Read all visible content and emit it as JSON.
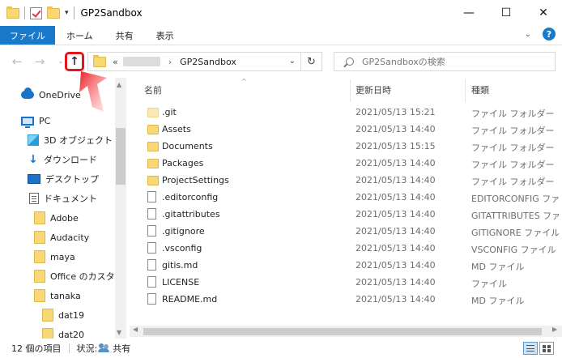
{
  "window": {
    "title": "GP2Sandbox",
    "minimize_glyph": "—",
    "maximize_glyph": "☐",
    "close_glyph": "✕"
  },
  "ribbon": {
    "tabs": [
      "ファイル",
      "ホーム",
      "共有",
      "表示"
    ],
    "help_glyph": "?"
  },
  "address": {
    "prefix": "«",
    "separator": "›",
    "current": "GP2Sandbox",
    "search_placeholder": "GP2Sandboxの検索"
  },
  "icons": {
    "back": "back-arrow-icon",
    "forward": "forward-arrow-icon",
    "up": "up-arrow-icon",
    "refresh": "refresh-icon",
    "search": "search-icon"
  },
  "colors": {
    "accent": "#1979ca",
    "highlight_red": "#e8141c",
    "folder": "#f8d775"
  },
  "sidebar": {
    "items": [
      {
        "label": "OneDrive",
        "icon": "onedrive-icon"
      },
      {
        "label": "PC",
        "icon": "pc-icon"
      },
      {
        "label": "3D オブジェクト",
        "icon": "3d-objects-icon"
      },
      {
        "label": "ダウンロード",
        "icon": "download-icon"
      },
      {
        "label": "デスクトップ",
        "icon": "desktop-icon"
      },
      {
        "label": "ドキュメント",
        "icon": "documents-icon"
      },
      {
        "label": "Adobe",
        "icon": "folder-icon"
      },
      {
        "label": "Audacity",
        "icon": "folder-icon"
      },
      {
        "label": "maya",
        "icon": "folder-icon"
      },
      {
        "label": "Office のカスタム",
        "icon": "folder-icon"
      },
      {
        "label": "tanaka",
        "icon": "folder-icon"
      },
      {
        "label": "dat19",
        "icon": "folder-icon"
      },
      {
        "label": "dat20",
        "icon": "folder-icon"
      }
    ]
  },
  "filelist": {
    "columns": [
      "名前",
      "更新日時",
      "種類"
    ],
    "rows": [
      {
        "name": ".git",
        "date": "2021/05/13 15:21",
        "type": "ファイル フォルダー",
        "kind": "folder"
      },
      {
        "name": "Assets",
        "date": "2021/05/13 14:40",
        "type": "ファイル フォルダー",
        "kind": "folder"
      },
      {
        "name": "Documents",
        "date": "2021/05/13 15:15",
        "type": "ファイル フォルダー",
        "kind": "folder"
      },
      {
        "name": "Packages",
        "date": "2021/05/13 14:40",
        "type": "ファイル フォルダー",
        "kind": "folder"
      },
      {
        "name": "ProjectSettings",
        "date": "2021/05/13 14:40",
        "type": "ファイル フォルダー",
        "kind": "folder"
      },
      {
        "name": ".editorconfig",
        "date": "2021/05/13 14:40",
        "type": "EDITORCONFIG ファ",
        "kind": "file"
      },
      {
        "name": ".gitattributes",
        "date": "2021/05/13 14:40",
        "type": "GITATTRIBUTES ファ",
        "kind": "file"
      },
      {
        "name": ".gitignore",
        "date": "2021/05/13 14:40",
        "type": "GITIGNORE ファイル",
        "kind": "file"
      },
      {
        "name": ".vsconfig",
        "date": "2021/05/13 14:40",
        "type": "VSCONFIG ファイル",
        "kind": "file"
      },
      {
        "name": "gitis.md",
        "date": "2021/05/13 14:40",
        "type": "MD ファイル",
        "kind": "file"
      },
      {
        "name": "LICENSE",
        "date": "2021/05/13 14:40",
        "type": "ファイル",
        "kind": "file"
      },
      {
        "name": "README.md",
        "date": "2021/05/13 14:40",
        "type": "MD ファイル",
        "kind": "file"
      }
    ]
  },
  "status": {
    "count": "12 個の項目",
    "state_label": "状況:",
    "share": "共有"
  }
}
